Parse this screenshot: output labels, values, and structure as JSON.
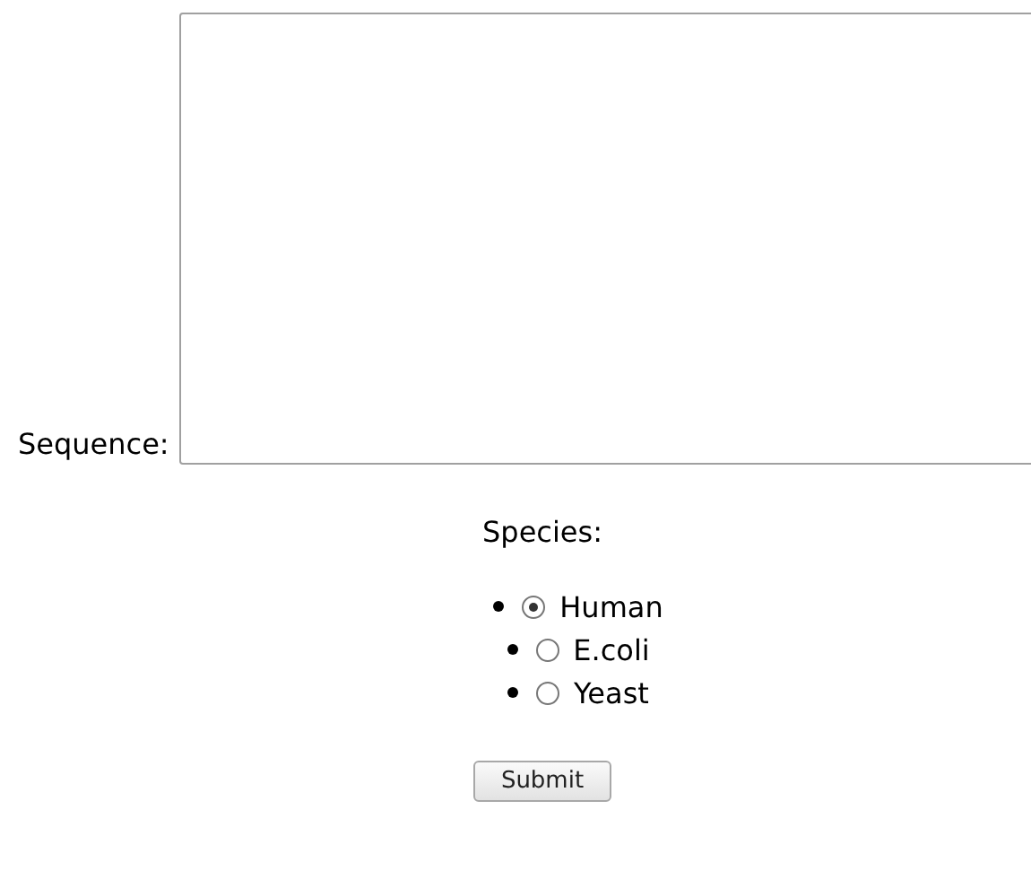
{
  "sequence": {
    "label": "Sequence:"
  },
  "species": {
    "label": "Species:",
    "options": [
      {
        "label": "Human",
        "selected": true
      },
      {
        "label": "E.coli",
        "selected": false
      },
      {
        "label": "Yeast",
        "selected": false
      }
    ]
  },
  "submit": {
    "label": "Submit"
  }
}
